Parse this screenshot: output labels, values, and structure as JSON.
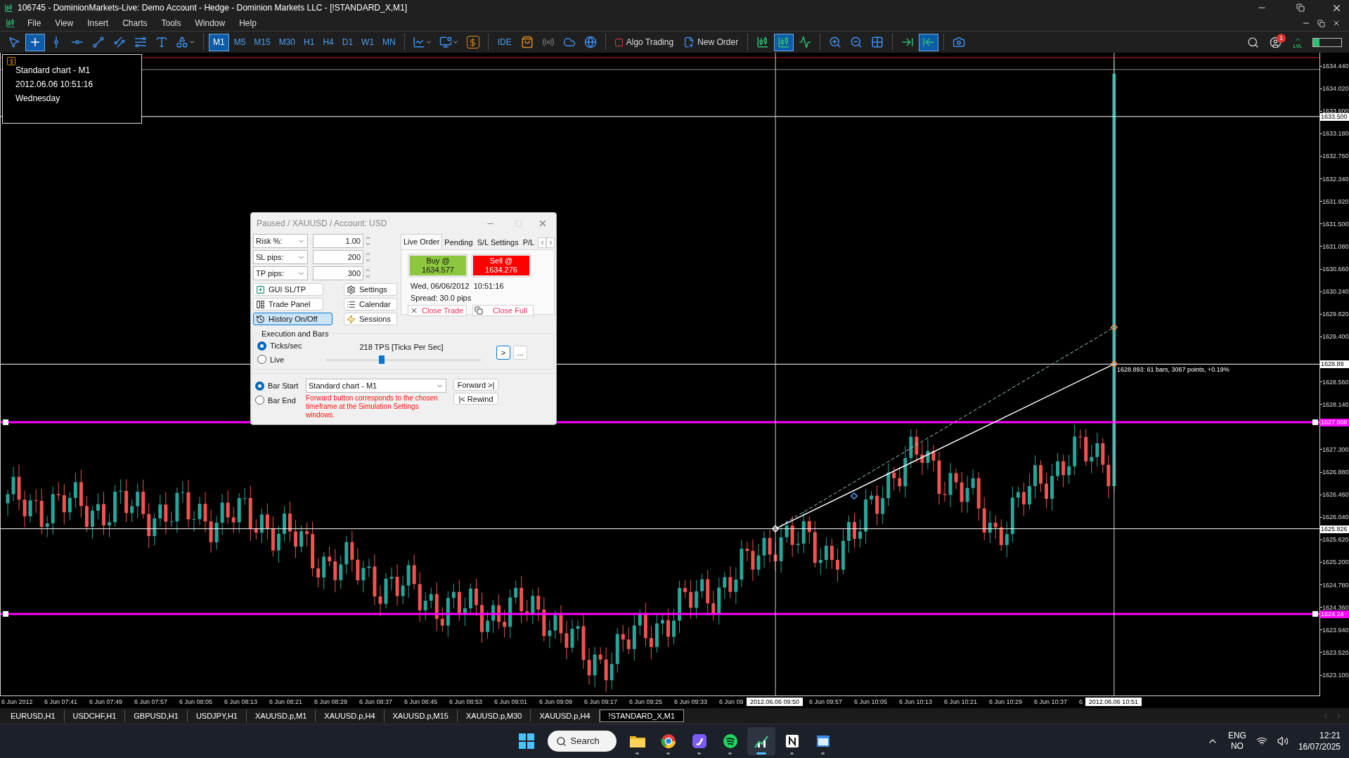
{
  "window": {
    "title": "106745 - DominionMarkets-Live: Demo Account - Hedge - Dominion Markets LLC - [!STANDARD_X,M1]"
  },
  "menu": [
    "File",
    "View",
    "Insert",
    "Charts",
    "Tools",
    "Window",
    "Help"
  ],
  "toolbar": {
    "items": [
      {
        "kind": "pointer",
        "selected": false
      },
      {
        "kind": "crosshair",
        "selected": true
      },
      {
        "kind": "vline",
        "selected": false
      },
      {
        "kind": "hline",
        "selected": false
      },
      {
        "kind": "trendline",
        "selected": false
      },
      {
        "kind": "channel",
        "selected": false
      },
      {
        "kind": "fibo",
        "selected": false
      },
      {
        "kind": "text",
        "selected": false
      },
      {
        "kind": "shapes",
        "selected": false
      },
      {
        "kind": "separator"
      },
      {
        "kind": "timeframe",
        "label": "M1",
        "selected": true
      },
      {
        "kind": "timeframe",
        "label": "M5",
        "selected": false
      },
      {
        "kind": "timeframe",
        "label": "M15",
        "selected": false
      },
      {
        "kind": "timeframe",
        "label": "M30",
        "selected": false
      },
      {
        "kind": "timeframe",
        "label": "H1",
        "selected": false
      },
      {
        "kind": "timeframe",
        "label": "H4",
        "selected": false
      },
      {
        "kind": "timeframe",
        "label": "D1",
        "selected": false
      },
      {
        "kind": "timeframe",
        "label": "W1",
        "selected": false
      },
      {
        "kind": "timeframe",
        "label": "MN",
        "selected": false
      },
      {
        "kind": "separator"
      },
      {
        "kind": "indicators"
      },
      {
        "kind": "templates"
      },
      {
        "kind": "market"
      },
      {
        "kind": "separator"
      },
      {
        "kind": "ide",
        "label": "IDE"
      },
      {
        "kind": "bag"
      },
      {
        "kind": "signals"
      },
      {
        "kind": "cloud"
      },
      {
        "kind": "vps"
      },
      {
        "kind": "separator"
      },
      {
        "kind": "algo",
        "label": "Algo Trading"
      },
      {
        "kind": "order",
        "label": "New Order"
      },
      {
        "kind": "separator"
      },
      {
        "kind": "bars",
        "selected": false
      },
      {
        "kind": "candles",
        "selected": true
      },
      {
        "kind": "line",
        "selected": false
      },
      {
        "kind": "separator"
      },
      {
        "kind": "zoom_in"
      },
      {
        "kind": "zoom_out"
      },
      {
        "kind": "tile"
      },
      {
        "kind": "separator"
      },
      {
        "kind": "shift",
        "selected": false
      },
      {
        "kind": "autoscroll",
        "selected": true
      },
      {
        "kind": "separator"
      },
      {
        "kind": "screenshot"
      }
    ],
    "right": [
      {
        "kind": "search"
      },
      {
        "kind": "account",
        "badge": "1"
      },
      {
        "kind": "lvl",
        "label": "LVL"
      },
      {
        "kind": "meter"
      }
    ]
  },
  "chart_info": [
    "Standard chart - M1",
    "2012.06.06 10:51:16",
    "Wednesday"
  ],
  "price_axis": {
    "ticks": [
      "1634.440",
      "1634.020",
      "1633.600",
      "1633.180",
      "1632.760",
      "1632.340",
      "1631.920",
      "1631.500",
      "1631.080",
      "1630.660",
      "1630.240",
      "1629.820",
      "1629.400",
      "1628.560",
      "1628.140",
      "1627.300",
      "1626.880",
      "1626.460",
      "1626.040",
      "1625.620",
      "1625.200",
      "1624.780",
      "1624.360",
      "1623.940",
      "1623.520",
      "1623.100"
    ],
    "markers": [
      {
        "label": "1633.500",
        "color": "#ffffff"
      },
      {
        "label": "1628.89",
        "color": "#ffffff"
      },
      {
        "label": "1627.808",
        "color": "#ff00ff"
      },
      {
        "label": "1625.826",
        "color": "#ffffff"
      },
      {
        "label": "1624.24",
        "color": "#ff00ff"
      }
    ]
  },
  "measure_label": "1628.893: 61 bars, 3067 points, +0.19%",
  "time_axis": {
    "labels": [
      "6 Jun 2012",
      "6 Jun 07:41",
      "6 Jun 07:49",
      "6 Jun 07:57",
      "6 Jun 08:05",
      "6 Jun 08:13",
      "6 Jun 08:21",
      "6 Jun 08:29",
      "6 Jun 08:37",
      "6 Jun 08:45",
      "6 Jun 08:53",
      "6 Jun 09:01",
      "6 Jun 09:09",
      "6 Jun 09:17",
      "6 Jun 09:25",
      "6 Jun 09:33",
      "6 Jun 09",
      "6 Jun 09:57",
      "6 Jun 10:05",
      "6 Jun 10:13",
      "6 Jun 10:21",
      "6 Jun 10:29",
      "6 Jun 10:37",
      "6"
    ],
    "markers": [
      "2012.06.06 09:50",
      "2012.06.06 10:51"
    ]
  },
  "sim_panel": {
    "title": "Paused / XAUUSD / Account: USD",
    "params": [
      {
        "label": "Risk %:",
        "value": "1.00"
      },
      {
        "label": "SL pips:",
        "value": "200"
      },
      {
        "label": "TP pips:",
        "value": "300"
      }
    ],
    "buttons": [
      {
        "label": "GUI SL/TP",
        "kind": "gui",
        "selected": false
      },
      {
        "label": "Settings",
        "kind": "settings",
        "selected": false
      },
      {
        "label": "Trade Panel",
        "kind": "panel",
        "selected": false
      },
      {
        "label": "Calendar",
        "kind": "calendar",
        "selected": false
      },
      {
        "label": "History On/Off",
        "kind": "history",
        "selected": true
      },
      {
        "label": "Sessions",
        "kind": "sessions",
        "selected": false
      }
    ],
    "tabs": [
      {
        "label": "Live Order",
        "selected": true
      },
      {
        "label": "Pending",
        "selected": false
      },
      {
        "label": "S/L Settings",
        "selected": false
      },
      {
        "label": "P/L",
        "selected": false
      }
    ],
    "buy": {
      "label": "Buy @",
      "price": "1634.577"
    },
    "sell": {
      "label": "Sell @",
      "price": "1634.276"
    },
    "server_time": "Wed, 06/06/2012  10:51:16",
    "spread": "Spread: 30.0 pips",
    "close_trade": "Close Trade",
    "close_full": "Close Full",
    "execution": {
      "title": "Execution and Bars",
      "modes": [
        {
          "label": "Ticks/sec",
          "selected": true
        },
        {
          "label": "Live",
          "selected": false
        }
      ],
      "reading": "218 TPS [Ticks Per Sec]",
      "level": 0.36,
      "play": ">",
      "more": "..."
    },
    "bars": {
      "modes": [
        {
          "label": "Bar Start",
          "selected": true
        },
        {
          "label": "Bar End",
          "selected": false
        }
      ],
      "timeframe": "Standard chart - M1",
      "note": "Forward button corresponds to the chosen timeframe at the Simulation Settings windows.",
      "forward": "Forward >|",
      "rewind": "|< Rewind"
    }
  },
  "chart_tabs": [
    {
      "label": "EURUSD,H1",
      "selected": false
    },
    {
      "label": "USDCHF,H1",
      "selected": false
    },
    {
      "label": "GBPUSD,H1",
      "selected": false
    },
    {
      "label": "USDJPY,H1",
      "selected": false
    },
    {
      "label": "XAUUSD.p,M1",
      "selected": false
    },
    {
      "label": "XAUUSD.p,H4",
      "selected": false
    },
    {
      "label": "XAUUSD.p,M15",
      "selected": false
    },
    {
      "label": "XAUUSD.p,M30",
      "selected": false
    },
    {
      "label": "XAUUSD.p,H4",
      "selected": false
    },
    {
      "label": "!STANDARD_X,M1",
      "selected": true
    }
  ],
  "taskbar": {
    "search": "Search",
    "apps": [
      {
        "kind": "folder",
        "active": false
      },
      {
        "kind": "browser",
        "active": false
      },
      {
        "kind": "purple",
        "active": false
      },
      {
        "kind": "music",
        "active": false
      },
      {
        "kind": "trader",
        "active": true
      },
      {
        "kind": "notes",
        "active": false
      },
      {
        "kind": "window",
        "active": false
      }
    ],
    "language": [
      "ENG",
      "NO"
    ],
    "time": "12:21",
    "date": "16/07/2025"
  }
}
